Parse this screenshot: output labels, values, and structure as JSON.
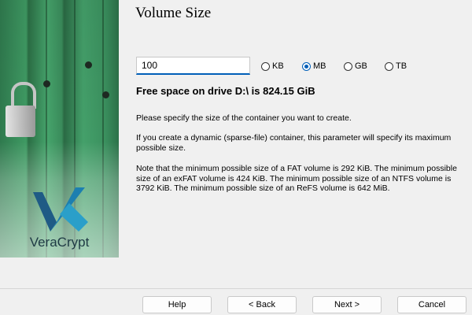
{
  "wizard": {
    "title": "Volume Size",
    "brand": {
      "logo_text": "VeraCrypt",
      "logo_icon": "veracrypt-logo-icon",
      "image": "padlock-on-green-door"
    },
    "size_input": {
      "value": "100"
    },
    "units": [
      {
        "label": "KB",
        "selected": false
      },
      {
        "label": "MB",
        "selected": true
      },
      {
        "label": "GB",
        "selected": false
      },
      {
        "label": "TB",
        "selected": false
      }
    ],
    "free_space": "Free space on drive D:\\ is 824.15 GiB",
    "paragraphs": [
      "Please specify the size of the container you want to create.",
      "If you create a dynamic (sparse-file) container, this parameter will specify its maximum possible size.",
      "Note that the minimum possible size of a FAT volume is 292 KiB. The minimum possible size of an exFAT volume is 424 KiB. The minimum possible size of an NTFS volume is 3792 KiB. The minimum possible size of an ReFS volume is 642 MiB."
    ],
    "buttons": {
      "help": "Help",
      "back": "< Back",
      "next": "Next >",
      "cancel": "Cancel"
    },
    "colors": {
      "accent": "#005fb8",
      "panel_green": "#3f9a63",
      "background": "#f0f0f0"
    }
  }
}
